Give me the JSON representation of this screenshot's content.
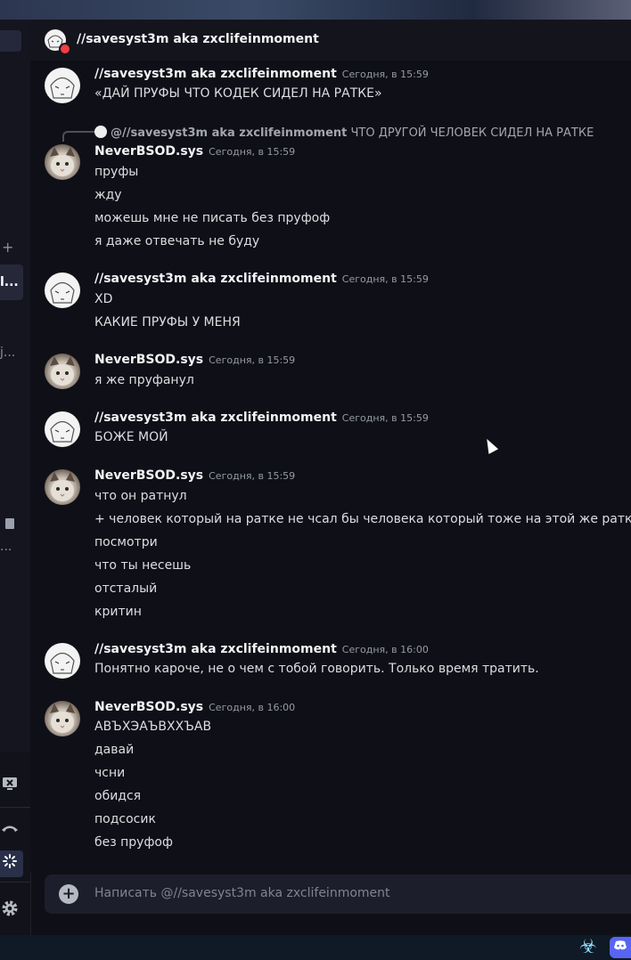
{
  "header": {
    "title": "//savesyst3m aka zxclifeinmoment"
  },
  "sidebar": {
    "active_item_label": "l...",
    "dim_item_label": "j...",
    "dots_label": "..."
  },
  "messages": [
    {
      "author": "//savesyst3m aka zxclifeinmoment",
      "time": "Сегодня, в 15:59",
      "lines": [
        "«ДАЙ ПРУФЫ ЧТО КОДЕК СИДЕЛ НА РАТКЕ»"
      ]
    },
    {
      "author": "NeverBSOD.sys",
      "time": "Сегодня, в 15:59",
      "reply_to": "@//savesyst3m aka zxclifeinmoment",
      "reply_text": "ЧТО ДРУГОЙ ЧЕЛОВЕК СИДЕЛ НА РАТКЕ",
      "lines": [
        "пруфы",
        "жду",
        "можешь мне не писать без пруфоф",
        "я даже отвечать не буду"
      ]
    },
    {
      "author": "//savesyst3m aka zxclifeinmoment",
      "time": "Сегодня, в 15:59",
      "lines": [
        "XD",
        "КАКИЕ ПРУФЫ У МЕНЯ"
      ]
    },
    {
      "author": "NeverBSOD.sys",
      "time": "Сегодня, в 15:59",
      "lines": [
        "я же пруфанул"
      ]
    },
    {
      "author": "//savesyst3m aka zxclifeinmoment",
      "time": "Сегодня, в 15:59",
      "lines": [
        "БОЖЕ МОЙ"
      ]
    },
    {
      "author": "NeverBSOD.sys",
      "time": "Сегодня, в 15:59",
      "lines": [
        "что он ратнул",
        "+ человек который на ратке не чсал бы человека который тоже на этой же ратке",
        "посмотри",
        "что ты несешь",
        "отсталый",
        "критин"
      ]
    },
    {
      "author": "//savesyst3m aka zxclifeinmoment",
      "time": "Сегодня, в 16:00",
      "lines": [
        "Понятно кароче, не о чем с тобой говорить. Только время тратить."
      ]
    },
    {
      "author": "NeverBSOD.sys",
      "time": "Сегодня, в 16:00",
      "lines": [
        "АВЪХЭАЪВХХЪАВ",
        "давай",
        "чсни",
        "обидся",
        "подсосик",
        "без пруфоф"
      ]
    }
  ],
  "composer": {
    "placeholder": "Написать @//savesyst3m aka zxclifeinmoment"
  },
  "icons": {
    "add": "plus-icon",
    "screen_share": "screen-share-off-icon",
    "disconnect": "phone-hangup-icon",
    "activity": "activity-icon",
    "settings": "gear-icon",
    "biohazard": "biohazard-icon",
    "discord": "discord-icon"
  }
}
